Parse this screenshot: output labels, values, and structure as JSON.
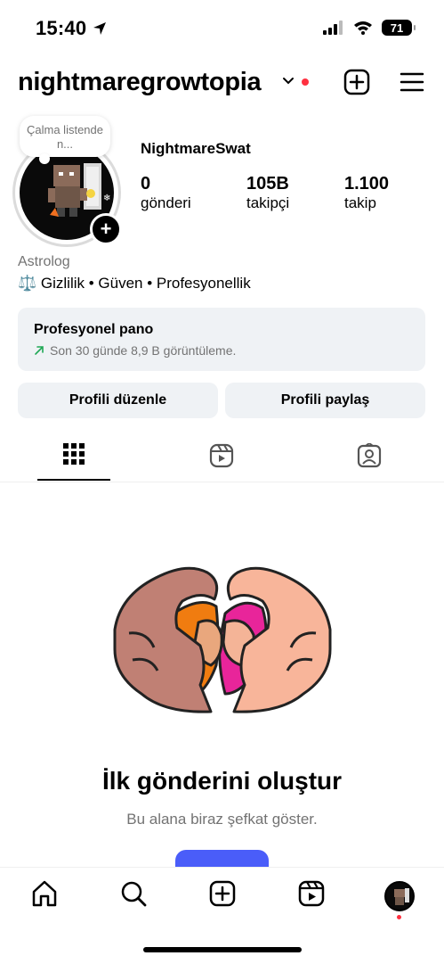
{
  "status_bar": {
    "time": "15:40",
    "battery": "71"
  },
  "header": {
    "username": "nightmaregrowtopia",
    "icons": [
      "chevron-down-icon",
      "create-icon",
      "menu-icon"
    ],
    "notification_dot_color": "#ff3040"
  },
  "profile": {
    "note": "Çalma listende n...",
    "display_name": "NightmareSwat",
    "stats": [
      {
        "value": "0",
        "label": "gönderi"
      },
      {
        "value": "105B",
        "label": "takipçi"
      },
      {
        "value": "1.100",
        "label": "takip"
      }
    ],
    "category": "Astrolog",
    "bio": "⚖️ Gizlilik • Güven • Profesyonellik"
  },
  "pro_dashboard": {
    "title": "Profesyonel pano",
    "subtitle": "Son 30 günde 8,9 B görüntüleme.",
    "trend_color": "#1fa855"
  },
  "actions": {
    "edit": "Profili düzenle",
    "share": "Profili paylaş"
  },
  "tabs": [
    {
      "icon": "grid-icon",
      "active": true
    },
    {
      "icon": "reels-icon",
      "active": false
    },
    {
      "icon": "tagged-icon",
      "active": false
    }
  ],
  "empty_state": {
    "title": "İlk gönderini oluştur",
    "subtitle": "Bu alana biraz şefkat göster.",
    "accent": "#4a5df9"
  },
  "bottom_nav": [
    "home-icon",
    "search-icon",
    "create-icon",
    "reels-icon",
    "profile-avatar"
  ]
}
